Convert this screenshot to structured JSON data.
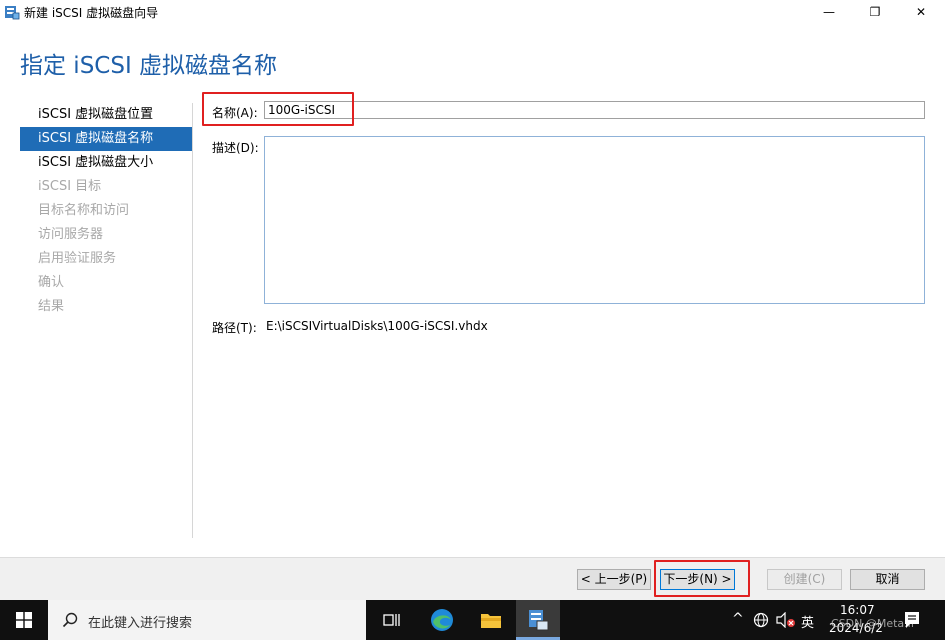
{
  "window": {
    "title": "新建 iSCSI 虚拟磁盘向导",
    "min_glyph": "—",
    "max_glyph": "❐",
    "close_glyph": "✕"
  },
  "page": {
    "title": "指定 iSCSI 虚拟磁盘名称"
  },
  "nav": {
    "items": [
      {
        "label": "iSCSI 虚拟磁盘位置",
        "state": "normal"
      },
      {
        "label": "iSCSI 虚拟磁盘名称",
        "state": "active"
      },
      {
        "label": "iSCSI 虚拟磁盘大小",
        "state": "normal"
      },
      {
        "label": "iSCSI 目标",
        "state": "disabled"
      },
      {
        "label": "目标名称和访问",
        "state": "disabled"
      },
      {
        "label": "访问服务器",
        "state": "disabled"
      },
      {
        "label": "启用验证服务",
        "state": "disabled"
      },
      {
        "label": "确认",
        "state": "disabled"
      },
      {
        "label": "结果",
        "state": "disabled"
      }
    ]
  },
  "form": {
    "name_label": "名称(A):",
    "name_value": "100G-iSCSI",
    "desc_label": "描述(D):",
    "desc_value": "",
    "path_label": "路径(T):",
    "path_value": "E:\\iSCSIVirtualDisks\\100G-iSCSI.vhdx"
  },
  "buttons": {
    "prev": "< 上一步(P)",
    "next": "下一步(N) >",
    "create": "创建(C)",
    "cancel": "取消"
  },
  "taskbar": {
    "search_placeholder": "在此键入进行搜索",
    "ime": "英",
    "time": "16:07",
    "date": "2024/6/2",
    "watermark": "CSDN @Meta.if"
  },
  "colors": {
    "accent": "#1f6cb6",
    "title_blue": "#1e5fa9",
    "highlight_red": "#e02020"
  }
}
